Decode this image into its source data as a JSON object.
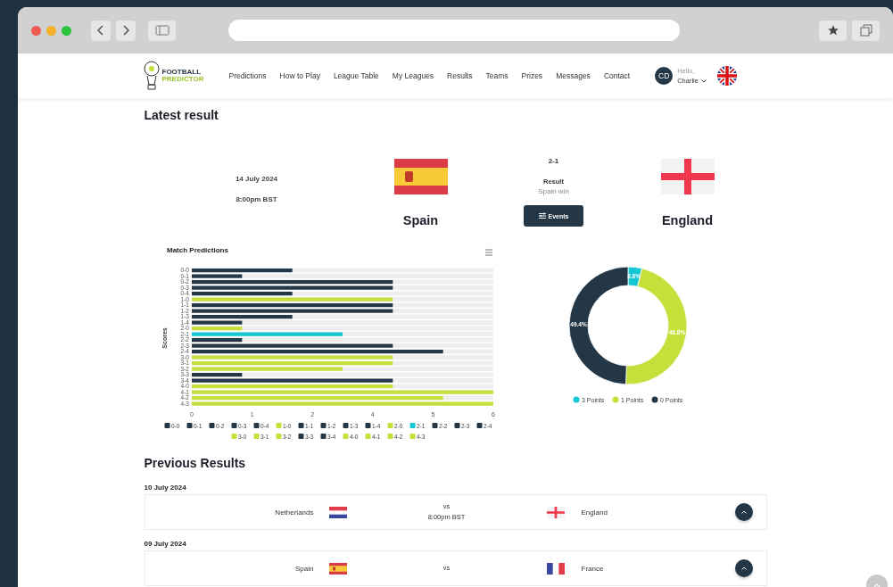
{
  "nav": {
    "logo": {
      "line1": "FOOTBALL",
      "line2": "PREDICTOR"
    },
    "items": [
      "Predictions",
      "How to Play",
      "League Table",
      "My Leagues",
      "Results",
      "Teams",
      "Prizes",
      "Messages",
      "Contact"
    ],
    "user": {
      "initials": "CD",
      "greeting": "Hello,",
      "name": "Charlie"
    }
  },
  "latest": {
    "heading": "Latest result",
    "date": "14 July 2024",
    "time": "8:00pm BST",
    "home": {
      "name": "Spain",
      "kind": "spanish"
    },
    "away": {
      "name": "England",
      "kind": "english"
    },
    "score": "2-1",
    "result_label": "Result",
    "result": "Spain win",
    "events_button": "Events"
  },
  "predictions_chart": {
    "chart_data": {
      "type": "bar",
      "orientation": "horizontal",
      "title": "Match Predictions",
      "ylabel": "Scores",
      "categories": [
        "0-0",
        "0-1",
        "0-2",
        "0-3",
        "0-4",
        "1-0",
        "1-1",
        "1-2",
        "1-3",
        "1-4",
        "2-0",
        "2-1",
        "2-2",
        "2-3",
        "2-4",
        "3-0",
        "3-1",
        "3-2",
        "3-3",
        "3-4",
        "4-0",
        "4-1",
        "4-2",
        "4-3"
      ],
      "values": [
        2,
        1,
        4,
        4,
        2,
        4,
        4,
        4,
        2,
        1,
        1,
        3,
        1,
        4,
        5,
        4,
        4,
        3,
        1,
        4,
        4,
        6,
        5,
        6
      ],
      "colors": [
        "#243746",
        "#243746",
        "#243746",
        "#243746",
        "#243746",
        "#c5e03a",
        "#243746",
        "#243746",
        "#243746",
        "#243746",
        "#c5e03a",
        "#13c8d3",
        "#243746",
        "#243746",
        "#243746",
        "#c5e03a",
        "#c5e03a",
        "#c5e03a",
        "#243746",
        "#243746",
        "#c5e03a",
        "#c5e03a",
        "#c5e03a",
        "#c5e03a"
      ],
      "xlim": [
        0,
        6
      ],
      "xticks": [
        {
          "value": 0,
          "label": "0"
        },
        {
          "value": 1.2,
          "label": "1"
        },
        {
          "value": 2.4,
          "label": "2"
        },
        {
          "value": 3.6,
          "label": "4"
        },
        {
          "value": 4.8,
          "label": "5"
        },
        {
          "value": 6,
          "label": "6"
        }
      ]
    }
  },
  "points_chart": {
    "chart_data": {
      "type": "donut",
      "categories": [
        "3 Points",
        "1 Points",
        "0 Points"
      ],
      "values": [
        3.8,
        46.8,
        49.4
      ],
      "colors": [
        "#13c8d3",
        "#c5e03a",
        "#243746"
      ],
      "data_labels": true,
      "legend": true,
      "value_labels": [
        "3.8%",
        "46.8%",
        "49.4%"
      ]
    }
  },
  "previous": {
    "heading": "Previous Results",
    "matches": [
      {
        "date": "10 July 2024",
        "home": {
          "name": "Netherlands",
          "kind": "dutch"
        },
        "vs": "vs",
        "time": "8:00pm BST",
        "away": {
          "name": "England",
          "kind": "english"
        }
      },
      {
        "date": "09 July 2024",
        "home": {
          "name": "Spain",
          "kind": "spanish"
        },
        "vs": "vs",
        "away": {
          "name": "France",
          "kind": "french"
        }
      }
    ]
  }
}
